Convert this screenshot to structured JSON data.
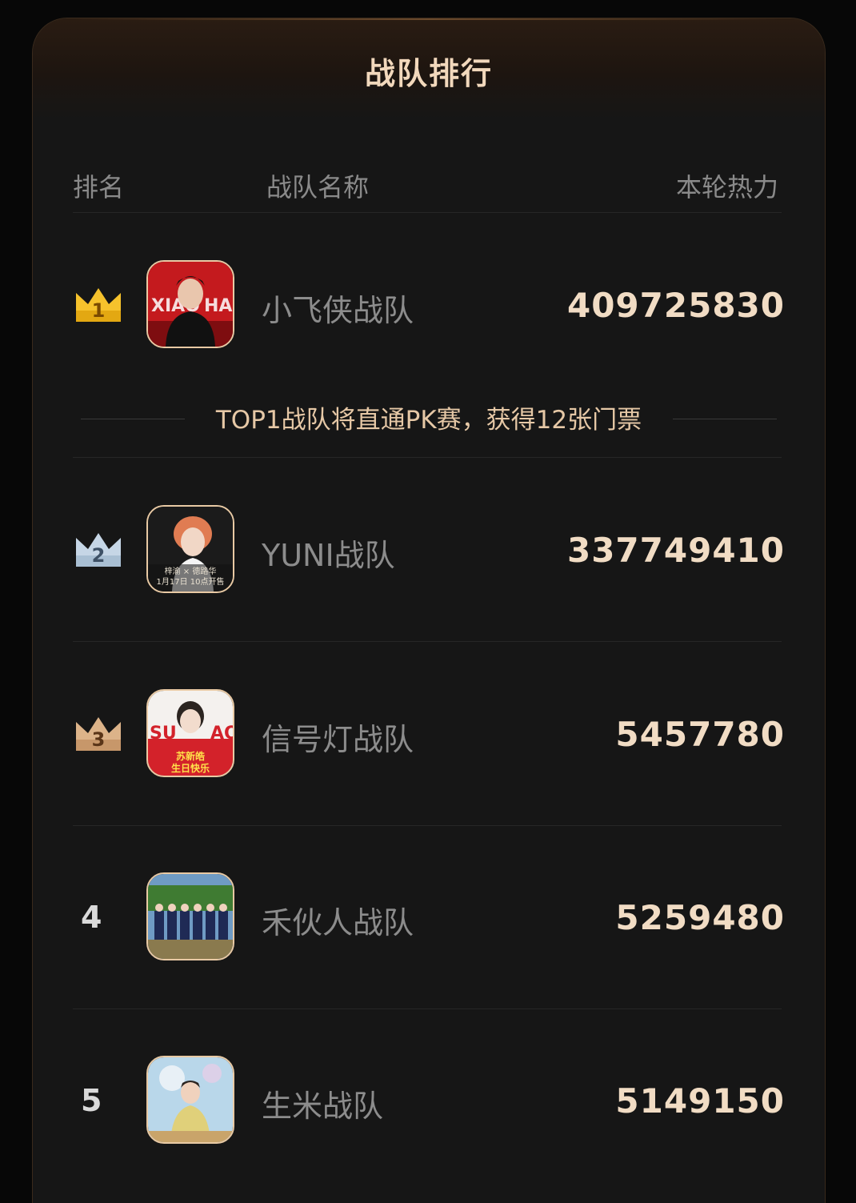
{
  "title": "战队排行",
  "columns": {
    "rank": "排名",
    "name": "战队名称",
    "heat": "本轮热力"
  },
  "notice": "TOP1战队将直通PK赛，获得12张门票",
  "rows": [
    {
      "rank": "1",
      "name": "小飞侠战队",
      "heat": "409725830"
    },
    {
      "rank": "2",
      "name": "YUNI战队",
      "heat": "337749410"
    },
    {
      "rank": "3",
      "name": "信号灯战队",
      "heat": "5457780"
    },
    {
      "rank": "4",
      "name": "禾伙人战队",
      "heat": "5259480"
    },
    {
      "rank": "5",
      "name": "生米战队",
      "heat": "5149150"
    }
  ],
  "avatar_text": {
    "a1_left": "XIAO",
    "a1_right": "HAN",
    "a2_line1": "梓渝 × 德路华",
    "a2_line2": "1月17日 10点开售",
    "a3_left": "SU",
    "a3_right": "AO",
    "a3_line1": "苏新皓",
    "a3_line2": "生日快乐"
  },
  "colors": {
    "gold": "#f6c22c",
    "silver": "#c6d6e6",
    "bronze": "#dcb389",
    "heat": "#f1dcc4",
    "title": "#f2d8bc"
  }
}
